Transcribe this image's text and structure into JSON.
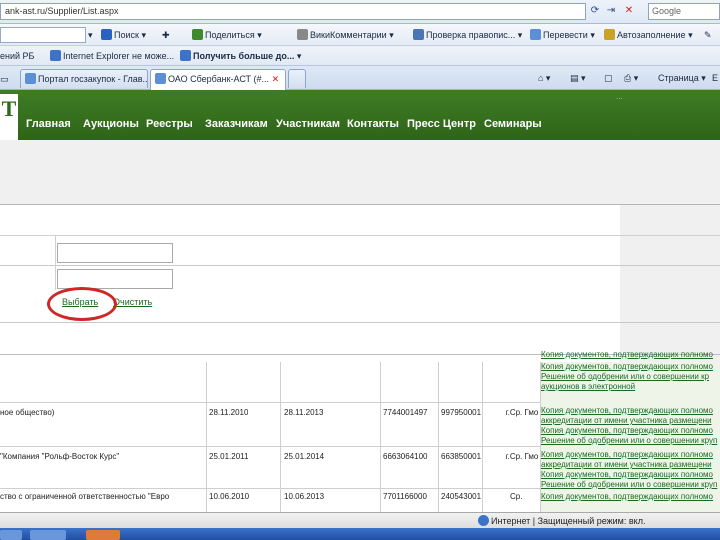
{
  "address": {
    "url": "ank-ast.ru/Supplier/List.aspx",
    "search_engine": "Google"
  },
  "toolbar": {
    "search_label": "Поиск",
    "share_label": "Поделиться",
    "wiki_label": "ВикиКомментарии",
    "spell_label": "Проверка правопис...",
    "translate_label": "Перевести",
    "autofill_label": "Автозаполнение"
  },
  "links": {
    "items": [
      "ений РБ",
      "Internet Explorer не може...",
      "Получить больше до..."
    ]
  },
  "tabs": [
    {
      "label": "Портал госзакупок - Глав..."
    },
    {
      "label": "ОАО Сбербанк-АСТ (#..."
    }
  ],
  "commands": {
    "page_label": "Страница"
  },
  "site": {
    "logo_text": "T",
    "header_note": "...",
    "nav": [
      "Главная",
      "Аукционы",
      "Реестры",
      "Заказчикам",
      "Участникам",
      "Контакты",
      "Пресс Центр",
      "Семинары"
    ]
  },
  "filter": {
    "select_label": "Выбрать",
    "clear_label": "Очистить"
  },
  "table": {
    "rows": [
      {
        "name": "",
        "date_from": "",
        "date_to": "",
        "inn": "",
        "kpp": "",
        "region": "",
        "docs": [
          "Копия документов, подтверждающих полномо",
          "Копия документов, подтверждающих полномо",
          "Решение об одобрении или о совершении кр",
          "аукционов в электронной"
        ]
      },
      {
        "name": "ное общество)",
        "date_from": "28.11.2010",
        "date_to": "28.11.2013",
        "inn": "7744001497",
        "kpp": "997950001",
        "region": "г.Ср. Гмо",
        "docs": [
          "Копия документов, подтверждающих полномо",
          "аккредитации от имени участника размещени",
          "Копия документов, подтверждающих полномо",
          "Решение об одобрении или о совершении круп"
        ]
      },
      {
        "name": "\"Компания \"Рольф-Восток Курс\"",
        "date_from": "25.01.2011",
        "date_to": "25.01.2014",
        "inn": "6663064100",
        "kpp": "663850001",
        "region": "г.Ср. Гмо",
        "docs": [
          "Копия документов, подтверждающих полномо",
          "аккредитации от имени участника размещени",
          "Копия документов, подтверждающих полномо",
          "Решение об одобрении или о совершении круп"
        ]
      },
      {
        "name": "ство с ограниченной ответственностью \"Евро",
        "date_from": "10.06.2010",
        "date_to": "10.06.2013",
        "inn": "7701166000",
        "kpp": "240543001",
        "region": "Ср.",
        "docs": [
          "Копия документов, подтверждающих полномо"
        ]
      }
    ]
  },
  "status": {
    "zone_text": "Интернет | Защищенный режим: вкл."
  },
  "colors": {
    "site_green": "#2e6418",
    "link_green": "#1a6a22",
    "annotation_red": "#d02626"
  }
}
